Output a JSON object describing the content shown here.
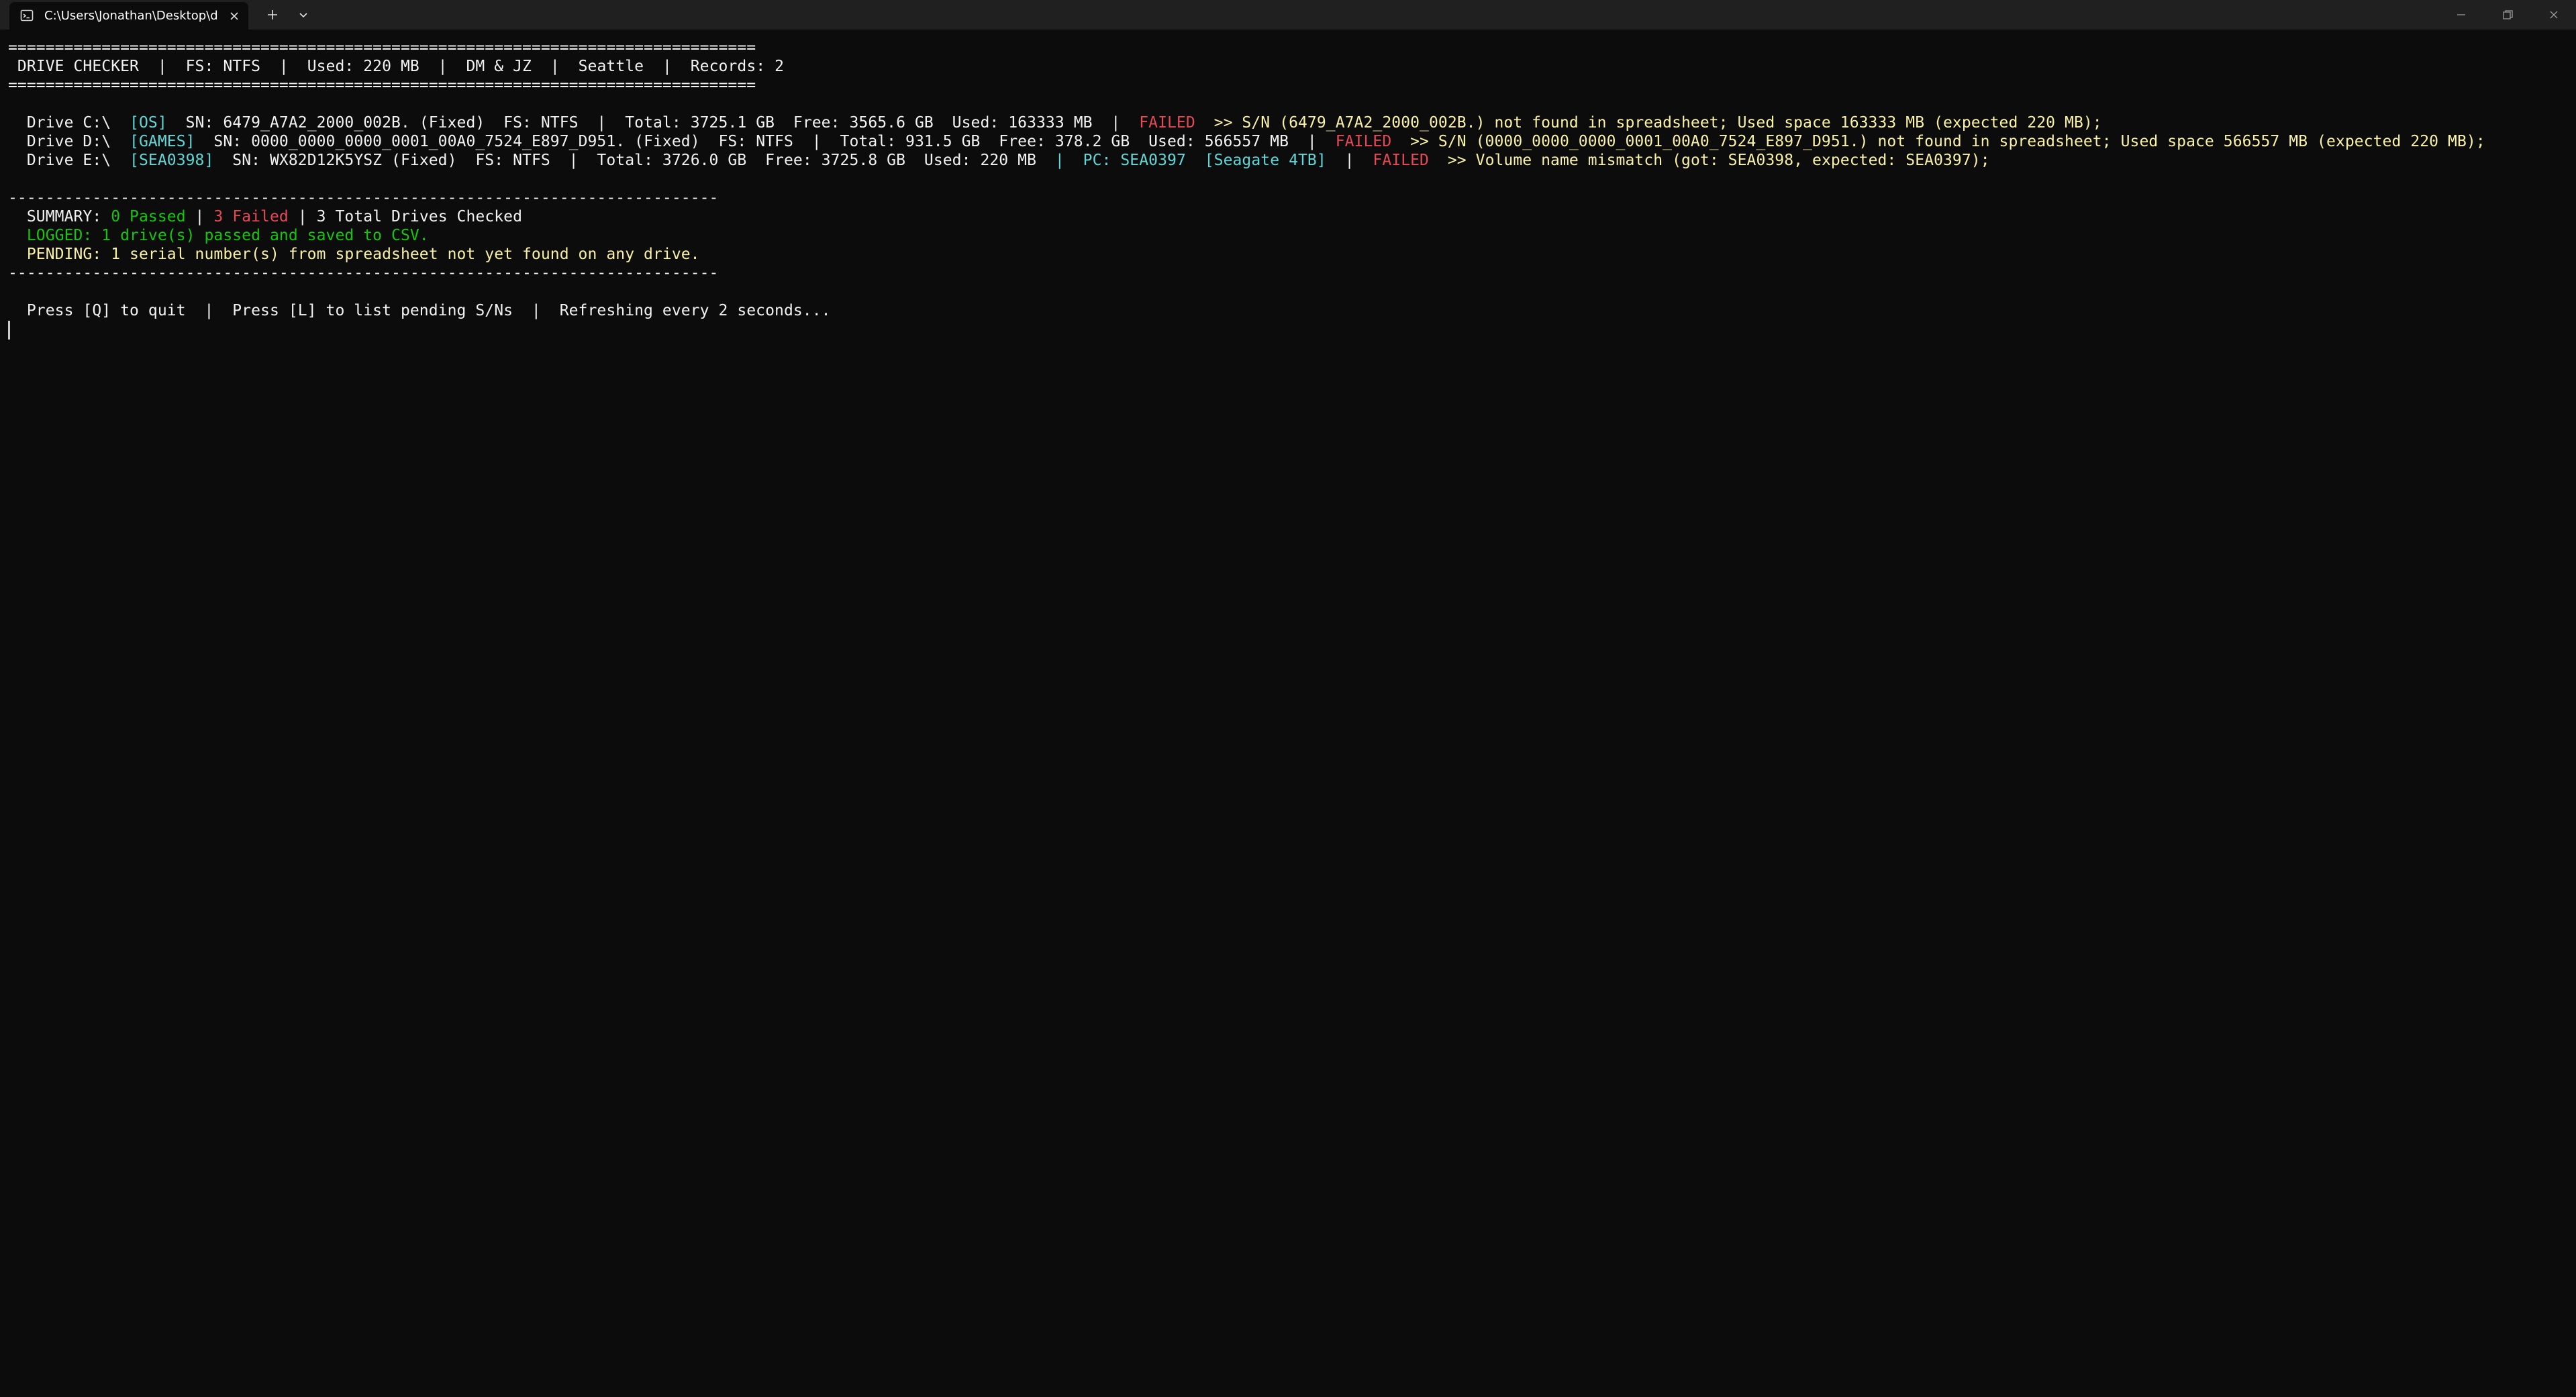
{
  "window": {
    "tab_title": "C:\\Users\\Jonathan\\Desktop\\d",
    "icons": {
      "tab": "terminal-icon",
      "close": "close-icon",
      "new_tab": "plus-icon",
      "dropdown": "chevron-down-icon",
      "minimize": "minimize-icon",
      "maximize": "restore-icon",
      "window_close": "close-icon"
    }
  },
  "colors": {
    "background": "#0c0c0c",
    "default_text": "#cccccc",
    "cyan": "#61d6d6",
    "red": "#e74856",
    "yellow": "#f9f1a5",
    "green": "#16c60c"
  },
  "header": {
    "rule": "================================================================================",
    "app": " DRIVE CHECKER",
    "sep": "  |  ",
    "fs": "FS: NTFS",
    "used": "Used: 220 MB",
    "initials": "DM & JZ",
    "location": "Seattle",
    "records": "Records: 2"
  },
  "drives": [
    {
      "label": "  Drive C:\\  ",
      "volume": "[OS]",
      "info": "  SN: 6479_A7A2_2000_002B. (Fixed)  FS: NTFS  |  Total: 3725.1 GB  Free: 3565.6 GB  Used: 163333 MB  |  ",
      "status": "FAILED",
      "message": "  >> S/N (6479_A7A2_2000_002B.) not found in spreadsheet; Used space 163333 MB (expected 220 MB);"
    },
    {
      "label": "  Drive D:\\  ",
      "volume": "[GAMES]",
      "info": "  SN: 0000_0000_0000_0001_00A0_7524_E897_D951. (Fixed)  FS: NTFS  |  Total: 931.5 GB  Free: 378.2 GB  Used: 566557 MB  |  ",
      "status": "FAILED",
      "message": "  >> S/N (0000_0000_0000_0001_00A0_7524_E897_D951.) not found in spreadsheet; Used space 566557 MB (expected 220 MB);"
    },
    {
      "label": "  Drive E:\\  ",
      "volume": "[SEA0398]",
      "info": "  SN: WX82D12K5YSZ (Fixed)  FS: NTFS  |  Total: 3726.0 GB  Free: 3725.8 GB  Used: 220 MB  ",
      "pc_sep": "|",
      "pc": "  PC: SEA0397  [Seagate 4TB]",
      "pc_tail": "  |  ",
      "status": "FAILED",
      "message": "  >> Volume name mismatch (got: SEA0398, expected: SEA0397);"
    }
  ],
  "summary": {
    "rule": "----------------------------------------------------------------------------",
    "label": "  SUMMARY: ",
    "passed": "0 Passed",
    "sep1": " | ",
    "failed": "3 Failed",
    "sep2": " | ",
    "total": "3 Total Drives Checked",
    "logged": "  LOGGED: 1 drive(s) passed and saved to CSV.",
    "pending": "  PENDING: 1 serial number(s) from spreadsheet not yet found on any drive."
  },
  "footer": {
    "help": "  Press [Q] to quit  |  Press [L] to list pending S/Ns  |  Refreshing every 2 seconds..."
  }
}
